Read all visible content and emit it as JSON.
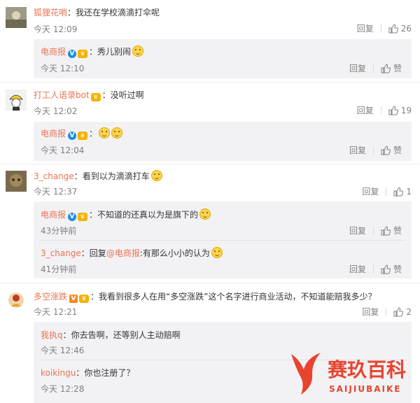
{
  "labels": {
    "reply": "回复",
    "like": "赞"
  },
  "comments": [
    {
      "user": "狐狸花哨",
      "text": "：我还在学校滴滴打伞呢",
      "time": "今天 12:09",
      "likes": "26",
      "replies": [
        {
          "user": "电商报",
          "text": "：秀儿别闹",
          "time": "今天 12:10",
          "likes": "赞"
        }
      ]
    },
    {
      "user": "打工人语录bot",
      "text": "：没听过啊",
      "time": "今天 12:02",
      "likes": "19",
      "replies": [
        {
          "user": "电商报",
          "text": "：",
          "time": "今天 12:04",
          "likes": "赞"
        }
      ]
    },
    {
      "user": "3_change",
      "text": "：看到以为滴滴打车",
      "time": "今天 12:37",
      "likes": "1",
      "replies": [
        {
          "user": "电商报",
          "text": "：不知道的还真以为是旗下的",
          "time": "43分钟前",
          "likes": "赞"
        },
        {
          "user": "3_change",
          "text": "：回复",
          "mention": "@电商报",
          "text2": ":有那么小小的认为",
          "time": "41分钟前",
          "likes": "赞"
        }
      ]
    },
    {
      "user": "多空涨跌",
      "text": "：我看到很多人在用“多空涨跌”这个名字进行商业活动，不知道能赔我多少？",
      "time": "今天 12:21",
      "likes": "2",
      "replies": [
        {
          "user": "我执q",
          "text": "：你去告啊，还等别人主动赔啊",
          "time": "今天 12:46"
        },
        {
          "user": "koikingu",
          "text": "：你也注册了？",
          "time": "今天 12:28"
        }
      ]
    }
  ],
  "watermark": {
    "cn": "赛玖百科",
    "en": "SAIJIUBAIKE",
    "color": "#e8432e"
  },
  "colors": {
    "name": "#eb7350",
    "meta": "#808080",
    "reply_bg": "#f2f2f5"
  }
}
